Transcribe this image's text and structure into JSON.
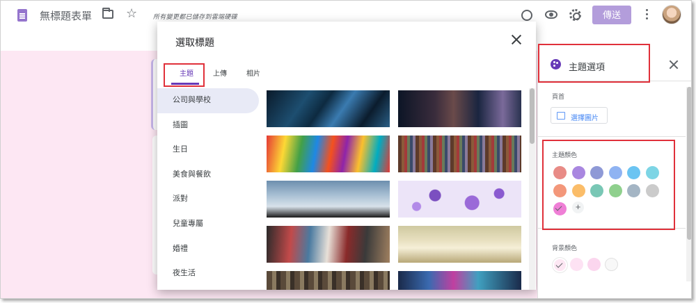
{
  "header": {
    "form_title": "無標題表單",
    "save_status": "所有變更都已儲存到雲端硬碟",
    "send_label": "傳送",
    "icons": [
      "doc-icon",
      "folder-icon",
      "star-icon",
      "palette-icon",
      "eye-icon",
      "gear-icon",
      "more-icon",
      "avatar"
    ]
  },
  "dialog": {
    "title": "選取標題",
    "tabs": [
      {
        "label": "主題",
        "active": true
      },
      {
        "label": "上傳",
        "active": false
      },
      {
        "label": "相片",
        "active": false
      }
    ],
    "categories": [
      {
        "label": "公司與學校",
        "active": true
      },
      {
        "label": "插圖",
        "active": false
      },
      {
        "label": "生日",
        "active": false
      },
      {
        "label": "美食與餐飲",
        "active": false
      },
      {
        "label": "派對",
        "active": false
      },
      {
        "label": "兒童專屬",
        "active": false
      },
      {
        "label": "婚禮",
        "active": false
      },
      {
        "label": "夜生活",
        "active": false
      }
    ],
    "images": [
      "network-lights",
      "guitar-player",
      "colorful-pills",
      "colored-threads",
      "basketball-hoop",
      "purple-bubbles",
      "sports-cleats",
      "open-book-heart",
      "tools-brushes",
      "lab-flasks"
    ]
  },
  "theme_panel": {
    "title": "主題選項",
    "header_label": "頁首",
    "choose_image_label": "選擇圖片",
    "theme_color_label": "主題顏色",
    "theme_colors": [
      "#e88b86",
      "#a987e0",
      "#8e99d6",
      "#8fb3f2",
      "#6bc4f2",
      "#7dd5e5",
      "#f3977a",
      "#fbbd69",
      "#79c7b5",
      "#8fd08d",
      "#a4b5c4",
      "#cbcbcb",
      "#ef7fd6"
    ],
    "selected_theme_color": "#ef7fd6",
    "background_color_label": "背景顏色",
    "background_colors": [
      "#fde7f3",
      "#fde2f3",
      "#fbd6ee",
      "#f8f8f8"
    ],
    "selected_background_color": "#fde7f3"
  },
  "colors": {
    "accent": "#673ab7",
    "send_button": "#b39ddb",
    "page_background": "#fde7f3",
    "highlight": "#e0303a"
  }
}
